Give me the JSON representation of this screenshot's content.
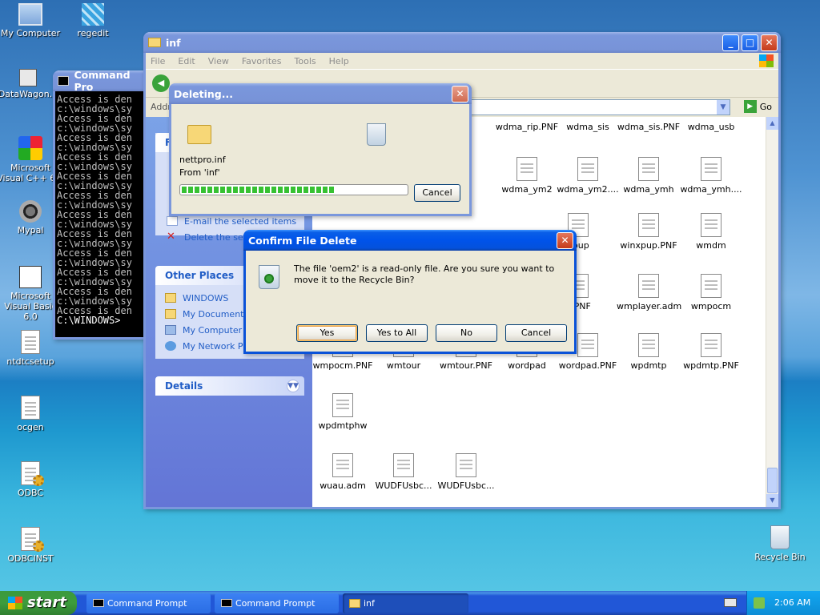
{
  "desktop": {
    "icons": [
      {
        "label": "My Computer"
      },
      {
        "label": "regedit"
      },
      {
        "label": "DataWagon..."
      },
      {
        "label": "Microsoft Visual C++ 6.0"
      },
      {
        "label": "Mypal"
      },
      {
        "label": "Microsoft Visual Basic 6.0"
      },
      {
        "label": "ntdtcsetup"
      },
      {
        "label": "ocgen"
      },
      {
        "label": "ODBC"
      },
      {
        "label": "ODBCINST"
      },
      {
        "label": "Recycle Bin"
      }
    ]
  },
  "cmd": {
    "title": "Command Pro",
    "lines": [
      "Access is den",
      "c:\\windows\\sy",
      "Access is den",
      "c:\\windows\\sy",
      "Access is den",
      "c:\\windows\\sy",
      "Access is den",
      "c:\\windows\\sy",
      "Access is den",
      "c:\\windows\\sy",
      "Access is den",
      "c:\\windows\\sy",
      "Access is den",
      "c:\\windows\\sy",
      "Access is den",
      "c:\\windows\\sy",
      "Access is den",
      "c:\\windows\\sy",
      "Access is den",
      "c:\\windows\\sy",
      "Access is den",
      "c:\\windows\\sy",
      "Access is den"
    ],
    "prompt": "C:\\WINDOWS>"
  },
  "explorer": {
    "title": "inf",
    "menu": [
      "File",
      "Edit",
      "View",
      "Favorites",
      "Tools",
      "Help"
    ],
    "address_label": "Addre",
    "go_label": "Go",
    "tasks": {
      "email": "E-mail the selected items",
      "delete": "Delete the sele"
    },
    "other_places": {
      "header": "Other Places",
      "items": [
        "WINDOWS",
        "My Documents",
        "My Computer",
        "My Network Pla"
      ]
    },
    "details_header": "Details",
    "files": [
      {
        "name": "rip"
      },
      {
        "name": "wdma_rip.PNF"
      },
      {
        "name": "wdma_sis"
      },
      {
        "name": "wdma_sis.PNF"
      },
      {
        "name": "wdma_usb"
      },
      {
        "name": ".PNF"
      },
      {
        "name": "wdma_ym2"
      },
      {
        "name": "wdma_ym2...."
      },
      {
        "name": "wdma_ymh"
      },
      {
        "name": "wdma_ymh...."
      },
      {
        "name": "xpup"
      },
      {
        "name": "winxpup.PNF"
      },
      {
        "name": "wmdm"
      },
      {
        "name": "p.PNF"
      },
      {
        "name": "wmplayer.adm"
      },
      {
        "name": "wmpocm"
      },
      {
        "name": "wmpocm.PNF"
      },
      {
        "name": "wmtour"
      },
      {
        "name": "wmtour.PNF"
      },
      {
        "name": "wordpad"
      },
      {
        "name": "wordpad.PNF"
      },
      {
        "name": "wpdmtp"
      },
      {
        "name": "wpdmtp.PNF"
      },
      {
        "name": "wpdmtphw"
      },
      {
        "name": "wuau.adm"
      },
      {
        "name": "WUDFUsbc..."
      },
      {
        "name": "WUDFUsbc..."
      }
    ]
  },
  "deleting": {
    "title": "Deleting...",
    "file": "nettpro.inf",
    "from": "From 'inf'",
    "progress": 0.68,
    "cancel": "Cancel"
  },
  "confirm": {
    "title": "Confirm File Delete",
    "message": "The file 'oem2' is a read-only file. Are you sure you want to move it to the Recycle Bin?",
    "buttons": {
      "yes": "Yes",
      "yes_all": "Yes to All",
      "no": "No",
      "cancel": "Cancel"
    }
  },
  "taskbar": {
    "start": "start",
    "tasks": [
      "Command Prompt",
      "Command Prompt",
      "inf"
    ],
    "clock": "2:06 AM"
  }
}
